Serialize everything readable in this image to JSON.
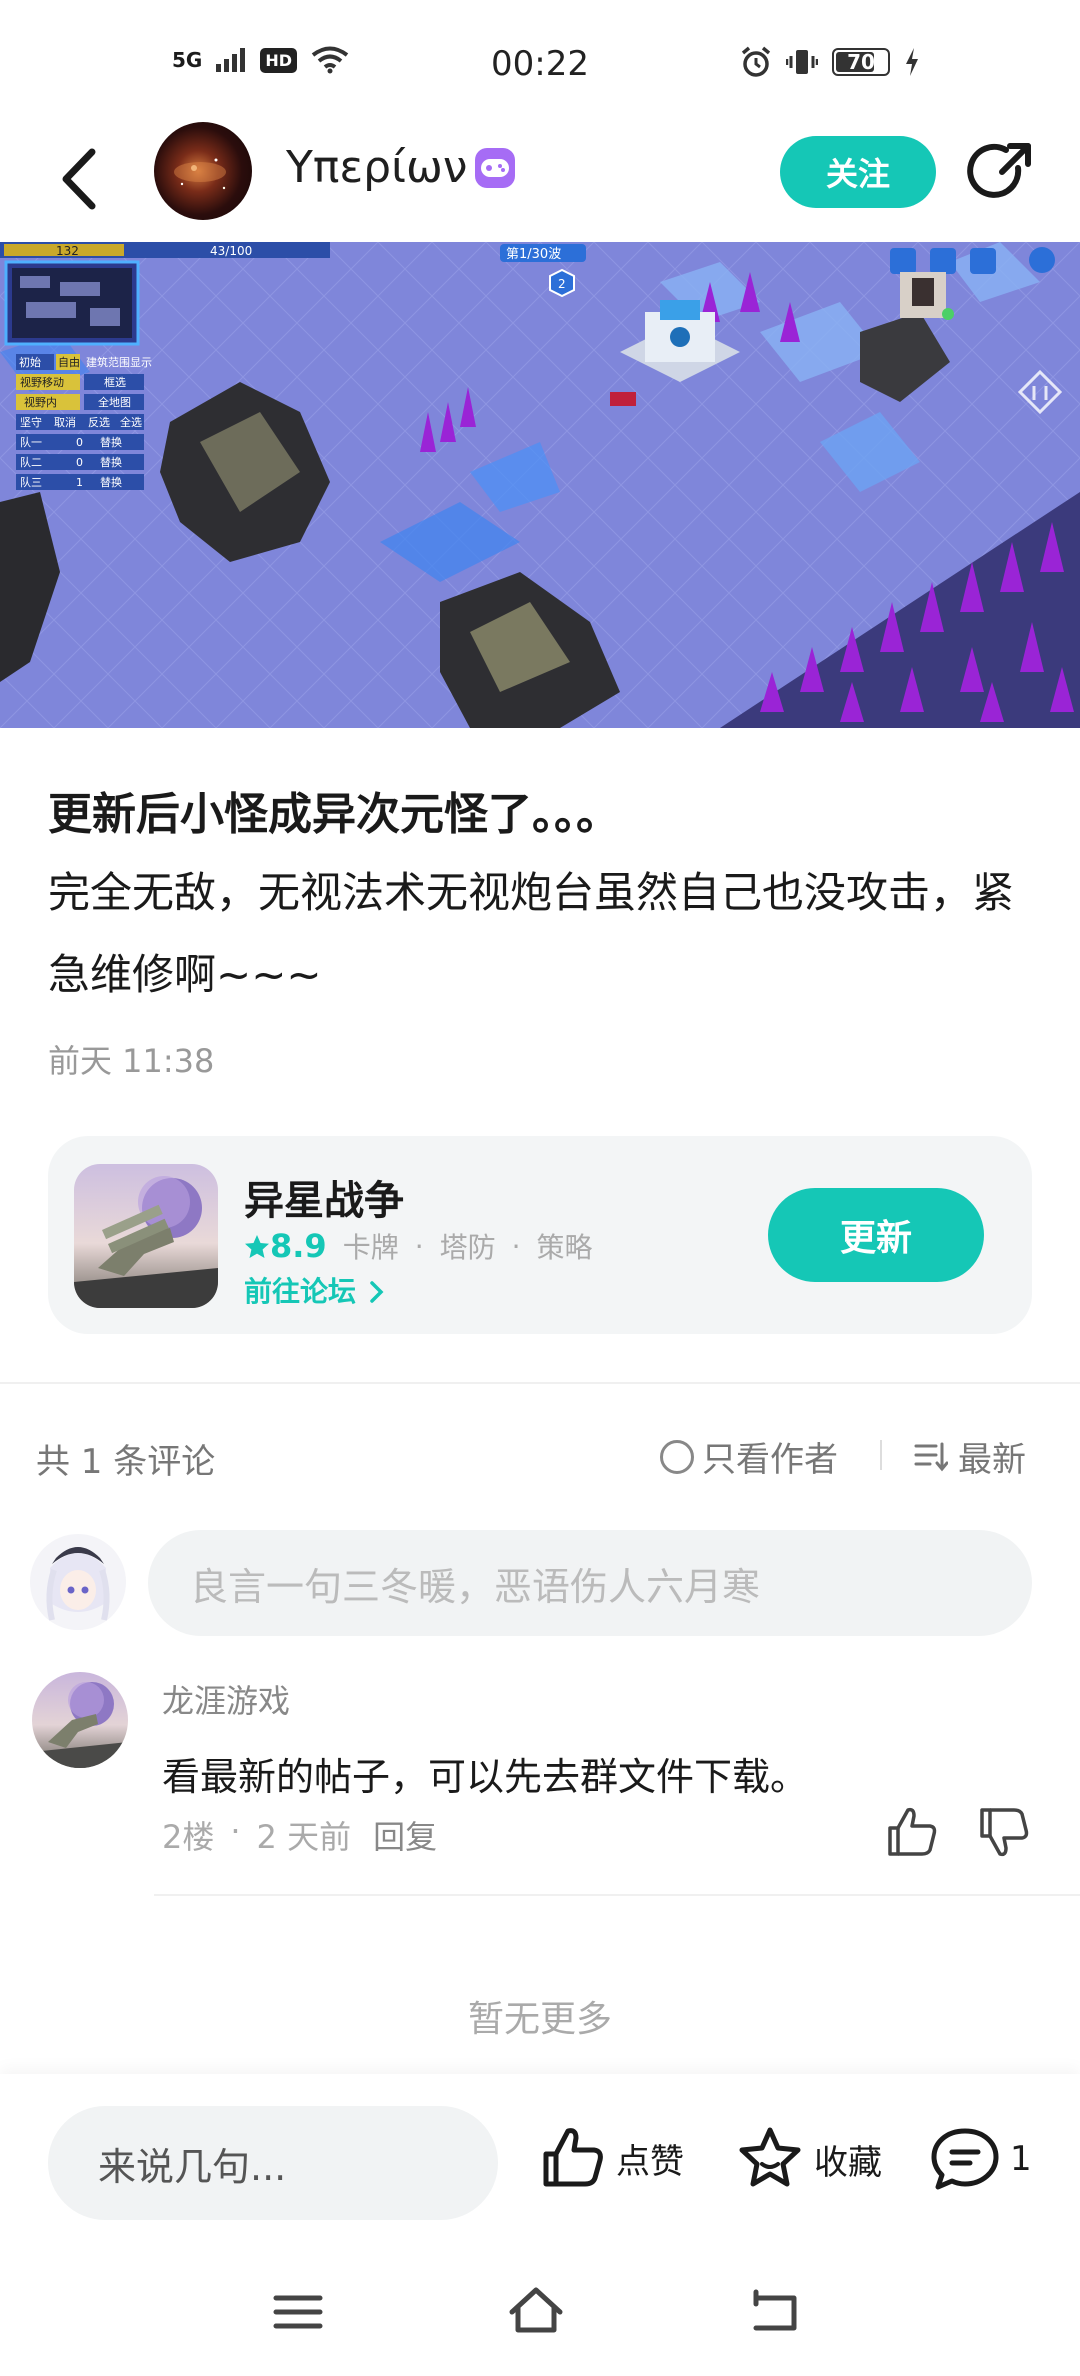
{
  "status_bar": {
    "network": "5G",
    "hd": "HD",
    "time": "00:22",
    "battery": "70"
  },
  "header": {
    "username": "Υπερίων",
    "follow_label": "关注"
  },
  "post": {
    "title": "更新后小怪成异次元怪了。。。",
    "body": "完全无敌，无视法术无视炮台虽然自己也没攻击，紧急维修啊~~~",
    "time": "前天 11:38"
  },
  "game_screenshot_hud": {
    "score": "132",
    "energy": "43/100",
    "wave": "第1/30波",
    "wave_next": "2",
    "menu": [
      "初始",
      "自由",
      "建筑范围显示",
      "视野移动",
      "框选",
      "视野内",
      "全地图",
      "坚守",
      "取消",
      "反选",
      "全选"
    ],
    "teams": [
      {
        "name": "队一",
        "count": "0",
        "action": "替换"
      },
      {
        "name": "队二",
        "count": "0",
        "action": "替换"
      },
      {
        "name": "队三",
        "count": "1",
        "action": "替换"
      }
    ]
  },
  "game_card": {
    "name": "异星战争",
    "rating": "8.9",
    "tags": [
      "卡牌",
      "塔防",
      "策略"
    ],
    "forum_link": "前往论坛",
    "update_label": "更新"
  },
  "comments_header": {
    "count": "共 1 条评论",
    "only_author": "只看作者",
    "sort": "最新"
  },
  "comment_input_placeholder": "良言一句三冬暖，恶语伤人六月寒",
  "comments": [
    {
      "author": "龙涯游戏",
      "text": "看最新的帖子，可以先去群文件下载。",
      "floor": "2楼",
      "time": "2 天前",
      "reply": "回复"
    }
  ],
  "no_more": "暂无更多",
  "bottom_bar": {
    "input_placeholder": "来说几句...",
    "like": "点赞",
    "favorite": "收藏",
    "comment_count": "1"
  },
  "colors": {
    "accent": "#15c7b6",
    "badge": "#a66cf5"
  },
  "icons": [
    "back-icon",
    "game-badge-icon",
    "share-icon",
    "thumbs-up-icon",
    "thumbs-down-icon",
    "star-icon",
    "comment-icon",
    "menu-icon",
    "home-icon",
    "return-icon"
  ]
}
